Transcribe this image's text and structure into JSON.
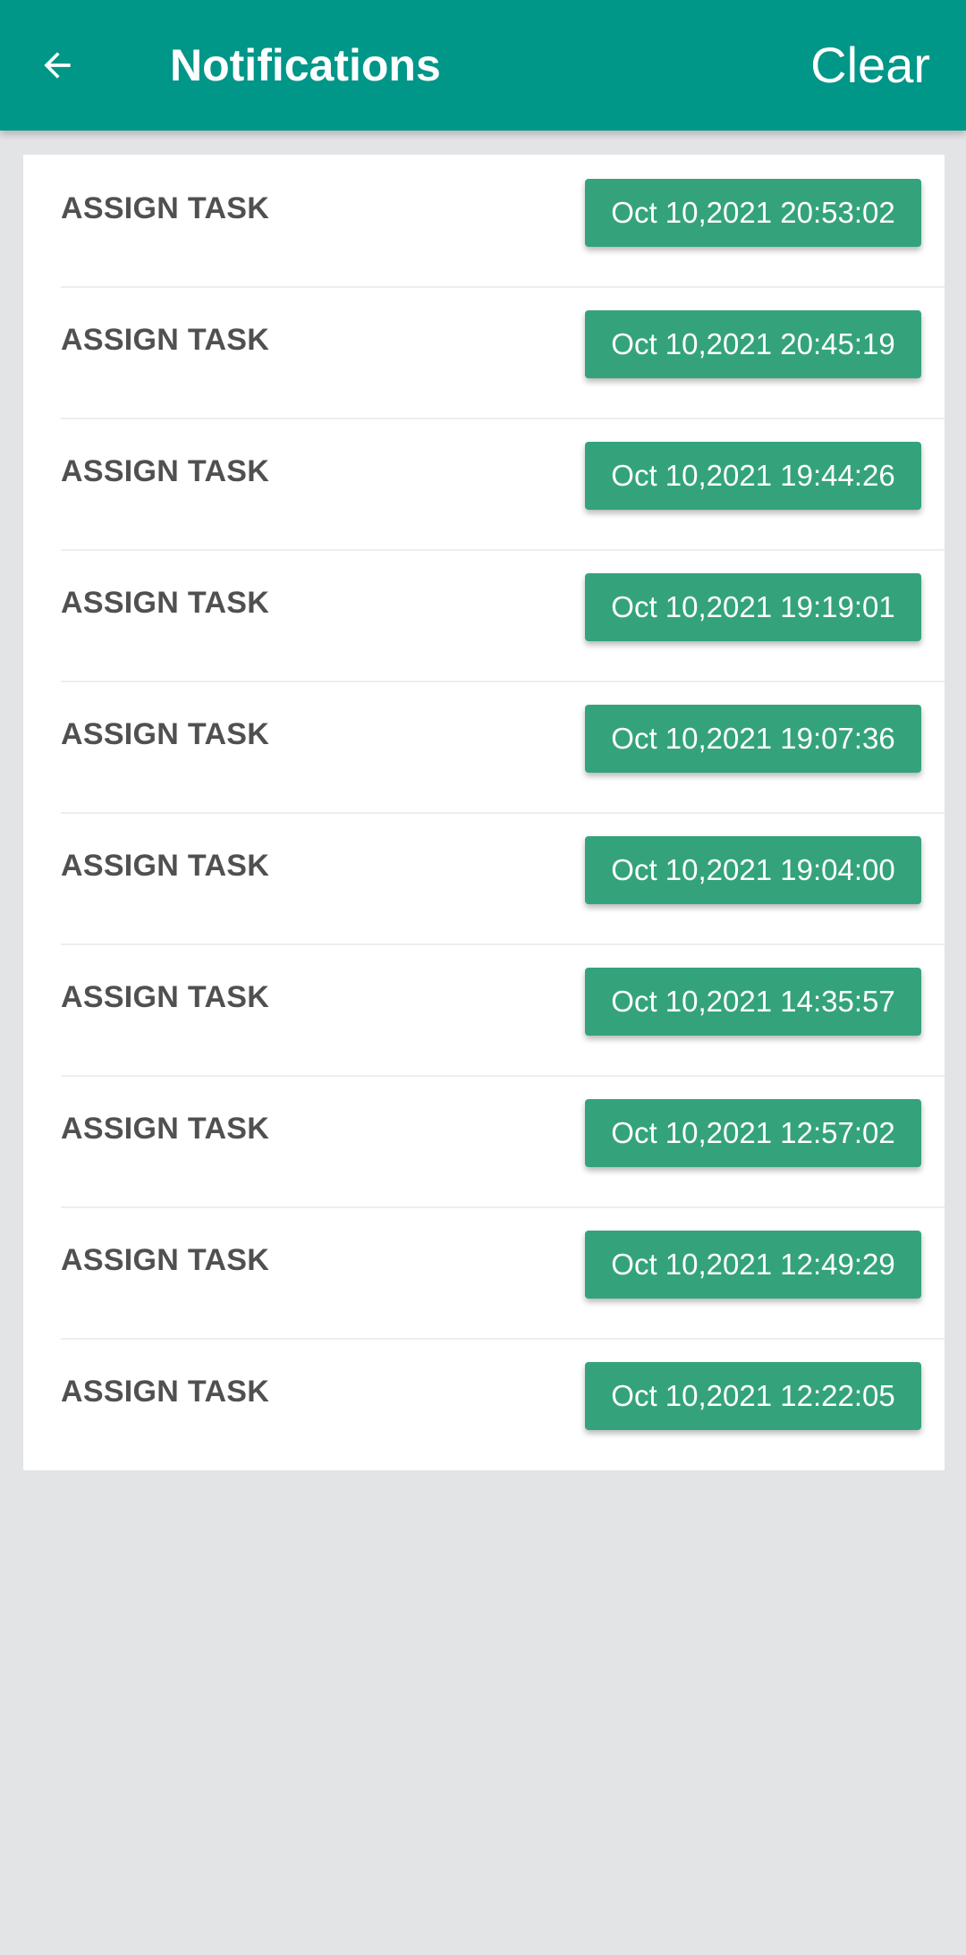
{
  "header": {
    "title": "Notifications",
    "back_icon": "arrow-left-icon",
    "clear_label": "Clear",
    "background_color": "#009688"
  },
  "notifications": [
    {
      "title": "ASSIGN TASK",
      "timestamp": "Oct 10,2021 20:53:02"
    },
    {
      "title": "ASSIGN TASK",
      "timestamp": "Oct 10,2021 20:45:19"
    },
    {
      "title": "ASSIGN TASK",
      "timestamp": "Oct 10,2021 19:44:26"
    },
    {
      "title": "ASSIGN TASK",
      "timestamp": "Oct 10,2021 19:19:01"
    },
    {
      "title": "ASSIGN TASK",
      "timestamp": "Oct 10,2021 19:07:36"
    },
    {
      "title": "ASSIGN TASK",
      "timestamp": "Oct 10,2021 19:04:00"
    },
    {
      "title": "ASSIGN TASK",
      "timestamp": "Oct 10,2021 14:35:57"
    },
    {
      "title": "ASSIGN TASK",
      "timestamp": "Oct 10,2021 12:57:02"
    },
    {
      "title": "ASSIGN TASK",
      "timestamp": "Oct 10,2021 12:49:29"
    },
    {
      "title": "ASSIGN TASK",
      "timestamp": "Oct 10,2021 12:22:05"
    }
  ],
  "colors": {
    "badge": "#34a37b",
    "page_background": "#e3e4e6"
  }
}
